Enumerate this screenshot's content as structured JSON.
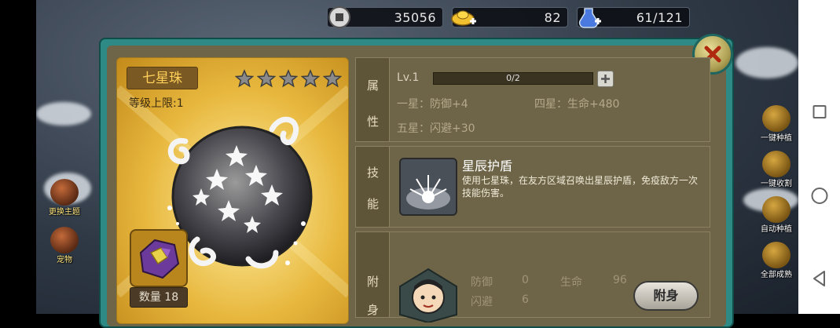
{
  "resources": {
    "coins": "35056",
    "ingots": "82",
    "stamina": "61/121"
  },
  "side_menu_right": [
    {
      "label": "一键种植",
      "icon": "seed-bag-icon"
    },
    {
      "label": "一键收割",
      "icon": "sickle-icon"
    },
    {
      "label": "自动种植",
      "icon": "auto-plant-icon"
    },
    {
      "label": "全部成熟",
      "icon": "harvest-icon"
    }
  ],
  "side_menu_left": [
    {
      "label": "更换主题"
    },
    {
      "label": "宠物"
    }
  ],
  "item": {
    "name": "七星珠",
    "level_limit": "等级上限:1",
    "star_count": 5,
    "quantity": "数量 18"
  },
  "attributes": {
    "label_chars": [
      "属",
      "性"
    ],
    "level": "Lv.1",
    "progress_text": "0/2",
    "progress_fraction": 0,
    "lines": [
      {
        "text": "一星：防御+4"
      },
      {
        "text": "四星：生命+480"
      },
      {
        "text": "五星：闪避+30"
      }
    ]
  },
  "skill": {
    "label_chars": [
      "技",
      "能"
    ],
    "name": "星辰护盾",
    "description": "使用七星珠，在友方区域召唤出星辰护盾，免疫敌方一次技能伤害。"
  },
  "attach": {
    "label_chars": [
      "附",
      "身"
    ],
    "stats": [
      {
        "label": "防御",
        "value": "0"
      },
      {
        "label": "生命",
        "value": "96"
      },
      {
        "label": "闪避",
        "value": "6"
      }
    ],
    "button_label": "附身"
  },
  "colors": {
    "panel_teal": "#2e8a84",
    "card_gold": "#e8b83e",
    "section_brown": "#6e6448"
  }
}
